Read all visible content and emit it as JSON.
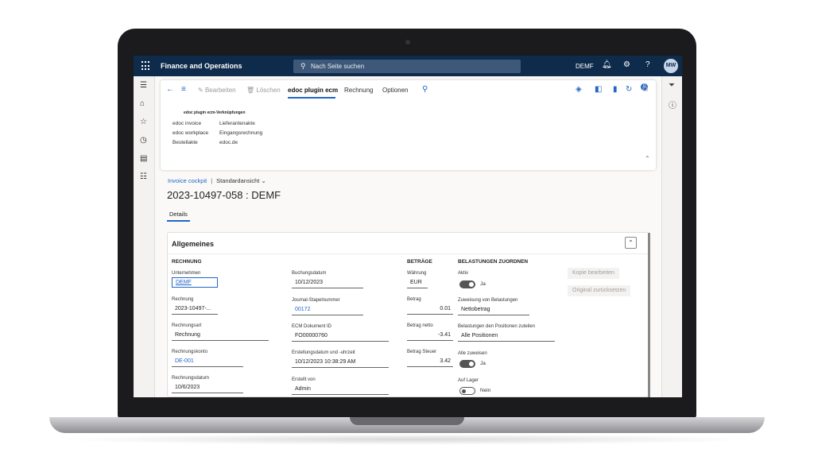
{
  "topbar": {
    "app_title": "Finance and Operations",
    "search_placeholder": "Nach Seite suchen",
    "company": "DEMF",
    "avatar": "MW"
  },
  "action_pane": {
    "items": [
      "Bearbeiten",
      "Löschen",
      "edoc plugin ecm",
      "Rechnung",
      "Optionen"
    ],
    "notification_count": "0",
    "group_title": "edoc plugin ecm-Verknüpfungen",
    "col1": [
      "edoc invoice",
      "edoc workplace",
      "Bestellakte"
    ],
    "col2": [
      "Lieferantenakte",
      "Eingangsrechnung",
      "edoc.de"
    ]
  },
  "breadcrumb": {
    "link": "Invoice cockpit",
    "separator": "|",
    "view": "Standardansicht"
  },
  "page_title": "2023-10497-058 : DEMF",
  "tab": "Details",
  "fasttab": {
    "title": "Allgemeines",
    "rechnung": {
      "header": "RECHNUNG",
      "unternehmen_label": "Unternehmen",
      "unternehmen": "DEMF",
      "rechnung_label": "Rechnung",
      "rechnung": "2023-10497-...",
      "rechnungsart_label": "Rechnungsart",
      "rechnungsart": "Rechnung",
      "rechnungskonto_label": "Rechnungskonto",
      "rechnungskonto": "DE-001",
      "rechnungsdatum_label": "Rechnungsdatum",
      "rechnungsdatum": "10/6/2023"
    },
    "col2": {
      "buchungsdatum_label": "Buchungsdatum",
      "buchungsdatum": "10/12/2023",
      "journal_label": "Journal-Stapelnummer",
      "journal": "00172",
      "ecm_label": "ECM Dokument ID",
      "ecm": "FO00000760",
      "erstellung_label": "Erstellungsdatum und -uhrzeit",
      "erstellung": "10/12/2023 10:38:29 AM",
      "erstellt_label": "Erstellt von",
      "erstellt": "Admin"
    },
    "betraege": {
      "header": "BETRÄGE",
      "waehrung_label": "Währung",
      "waehrung": "EUR",
      "betrag_label": "Betrag",
      "betrag": "0.01",
      "netto_label": "Betrag netto",
      "netto": "-3.41",
      "steuer_label": "Betrag Steuer",
      "steuer": "3.42"
    },
    "belastungen": {
      "header": "BELASTUNGEN ZUORDNEN",
      "aktiv_label": "Aktiv",
      "aktiv_val": "Ja",
      "zuweisung_label": "Zuweisung von Belastungen",
      "zuweisung": "Nettobetrag",
      "positionen_label": "Belastungen den Positionen zuteilen",
      "positionen": "Alle Positionen",
      "alle_label": "Alle zuweisen",
      "alle_val": "Ja",
      "lager_label": "Auf Lager",
      "lager_val": "Nein"
    },
    "buttons": {
      "kopie": "Kopie bearbeiten",
      "original": "Original zurücksetzen"
    }
  }
}
